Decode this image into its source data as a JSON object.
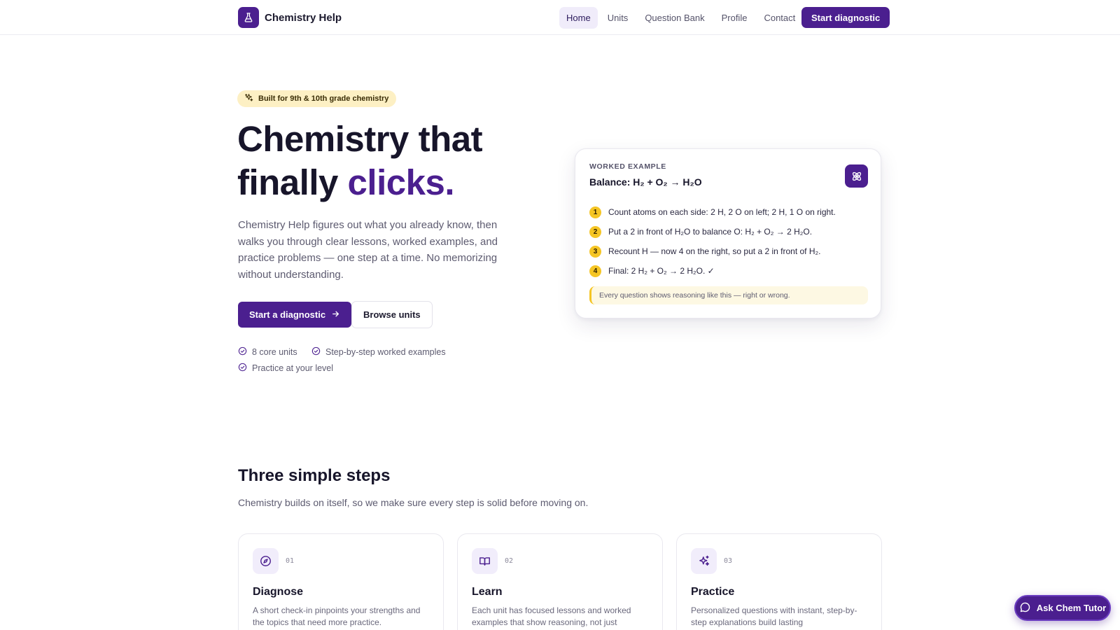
{
  "nav": {
    "brand": "Chemistry Help",
    "links": [
      {
        "label": "Home",
        "active": true
      },
      {
        "label": "Units",
        "active": false
      },
      {
        "label": "Question Bank",
        "active": false
      },
      {
        "label": "Profile",
        "active": false
      },
      {
        "label": "Contact",
        "active": false
      }
    ],
    "cta": "Start diagnostic",
    "brand_icon": "flask-icon"
  },
  "hero": {
    "badge": "Built for 9th & 10th grade chemistry",
    "badge_icon": "sparkles-icon",
    "title_line1": "Chemistry that",
    "title_line2_plain": "finally ",
    "title_line2_accent": "clicks.",
    "description": "Chemistry Help figures out what you already know, then walks you through clear lessons, worked examples, and practice problems — one step at a time. No memorizing without understanding.",
    "primary_button": "Start a diagnostic",
    "secondary_button": "Browse units",
    "features": [
      "8 core units",
      "Step-by-step worked examples",
      "Practice at your level"
    ]
  },
  "worked_example": {
    "eyebrow": "WORKED EXAMPLE",
    "title": "Balance: H₂ + O₂ → H₂O",
    "icon": "atom-icon",
    "steps": [
      {
        "num": "1",
        "text": "Count atoms on each side: 2 H, 2 O on left; 2 H, 1 O on right."
      },
      {
        "num": "2",
        "text": "Put a 2 in front of H₂O to balance O: H₂ + O₂ → 2 H₂O."
      },
      {
        "num": "3",
        "text": "Recount H — now 4 on the right, so put a 2 in front of H₂."
      },
      {
        "num": "4",
        "text": "Final: 2 H₂ + O₂ → 2 H₂O. ✓"
      }
    ],
    "note": "Every question shows reasoning like this — right or wrong."
  },
  "steps_section": {
    "title": "Three simple steps",
    "subtitle": "Chemistry builds on itself, so we make sure every step is solid before moving on.",
    "cards": [
      {
        "num": "01",
        "title": "Diagnose",
        "icon": "compass-icon",
        "desc": "A short check-in pinpoints your strengths and the topics that need more practice."
      },
      {
        "num": "02",
        "title": "Learn",
        "icon": "book-icon",
        "desc": "Each unit has focused lessons and worked examples that show reasoning, not just"
      },
      {
        "num": "03",
        "title": "Practice",
        "icon": "sparkles-icon",
        "desc": "Personalized questions with instant, step-by-step explanations build lasting"
      }
    ]
  },
  "tutor": {
    "label": "Ask Chem Tutor",
    "icon": "chat-bubble-icon"
  },
  "colors": {
    "brand": "#4b1f8f",
    "accent_yellow": "#f5c524",
    "badge_bg": "#fdf0c4"
  }
}
